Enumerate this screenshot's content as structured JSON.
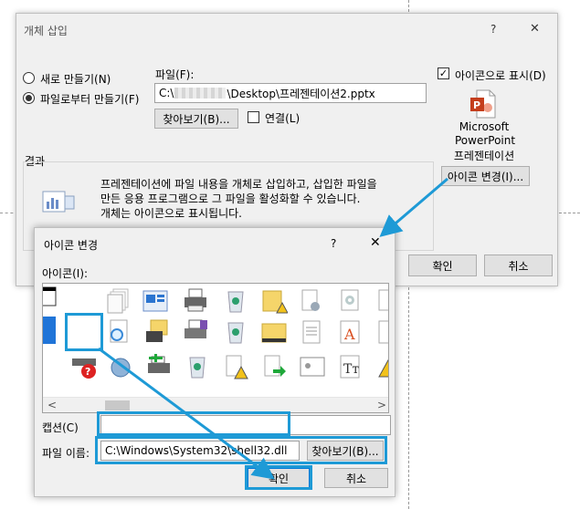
{
  "outer_dialog": {
    "title": "개체 삽입",
    "help": "?",
    "close": "✕",
    "radio_new": "새로 만들기(N)",
    "radio_from_file": "파일로부터 만들기(F)",
    "file_label": "파일(F):",
    "file_value_prefix": "C:\\",
    "file_value_suffix": "\\Desktop\\프레젠테이션2.pptx",
    "browse": "찾아보기(B)...",
    "link": "연결(L)",
    "display_as_icon": "아이콘으로 표시(D)",
    "icon_caption_1": "Microsoft",
    "icon_caption_2": "PowerPoint",
    "icon_caption_3": "프레젠테이션",
    "change_icon": "아이콘 변경(I)...",
    "result_label": "결과",
    "result_text_1": "프레젠테이션에 파일 내용을 개체로 삽입하고, 삽입한 파일을",
    "result_text_2": "만든 응용 프로그램으로 그 파일을 활성화할 수 있습니다.",
    "result_text_3": "개체는 아이콘으로 표시됩니다.",
    "ok": "확인",
    "cancel": "취소"
  },
  "change_icon_dialog": {
    "title": "아이콘 변경",
    "help": "?",
    "close": "✕",
    "icon_label": "아이콘(I):",
    "caption_label": "캡션(C)",
    "caption_value": "",
    "filename_label": "파일 이름:",
    "filename_value": "C:\\Windows\\System32\\shell32.dll",
    "browse": "찾아보기(B)...",
    "ok": "확인",
    "cancel": "취소",
    "scroll_left": "<",
    "scroll_right": ">"
  },
  "colors": {
    "highlight": "#1e9ad6",
    "powerpoint": "#c43e1c",
    "dialog_bg": "#f0f0f0"
  }
}
